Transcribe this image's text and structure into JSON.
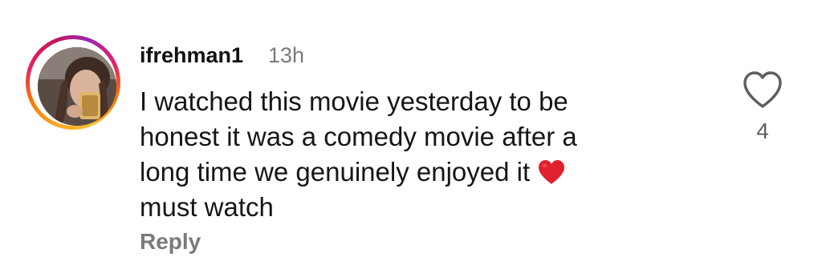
{
  "comment": {
    "username": "ifrehman1",
    "timestamp": "13h",
    "text_lines": [
      "I watched this movie yesterday to be",
      "honest it was a comedy movie after a",
      "long time we genuinely enjoyed it",
      "must watch"
    ],
    "emoji": "❤️",
    "reply_label": "Reply",
    "like_count": "4"
  },
  "icons": {
    "like": "heart-outline-icon",
    "emoji": "red-heart-emoji"
  },
  "colors": {
    "text": "#111111",
    "muted": "#7a7a7a",
    "heart_emoji": "#e0212f"
  }
}
